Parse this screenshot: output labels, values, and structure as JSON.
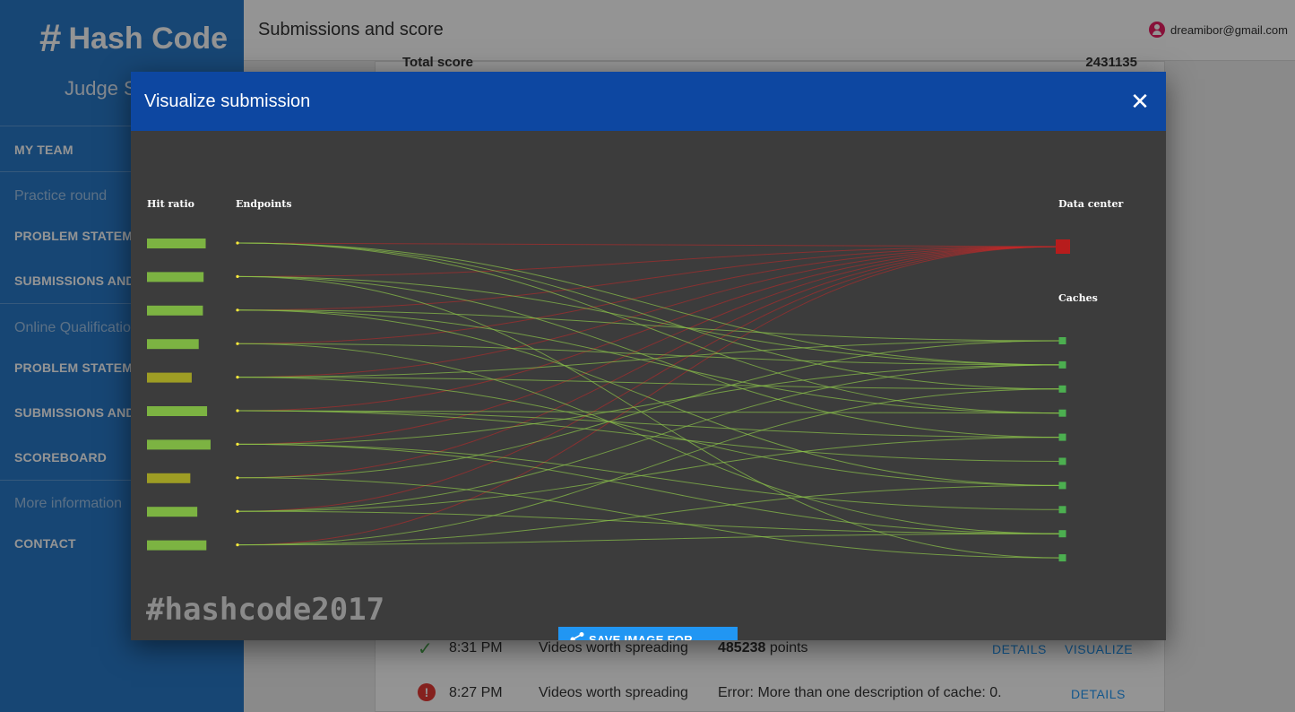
{
  "sidebar": {
    "brand_hash": "#",
    "brand_name": "Hash Code",
    "subtitle": "Judge S",
    "my_team": "MY TEAM",
    "practice_round": "Practice round",
    "practice_problem": "PROBLEM STATEME",
    "practice_submissions": "SUBMISSIONS AND",
    "online_qualification": "Online Qualificatio",
    "online_problem": "PROBLEM STATEME",
    "online_submissions": "SUBMISSIONS AND",
    "scoreboard": "SCOREBOARD",
    "more_information": "More information",
    "contact": "CONTACT"
  },
  "topbar": {
    "title": "Submissions and score",
    "user_email": "dreamibor@gmail.com",
    "user_icon": "account-circle-icon"
  },
  "content": {
    "total_label": "Total score",
    "total_value": "2431135",
    "rows": [
      {
        "status": "ok",
        "time": "8:31 PM",
        "dataset": "Videos worth spreading",
        "score": "485238",
        "score_unit": "points",
        "details": "DETAILS",
        "visualize": "VISUALIZE"
      },
      {
        "status": "error",
        "time": "8:27 PM",
        "dataset": "Videos worth spreading",
        "error": "Error: More than one description of cache: 0.",
        "details": "DETAILS"
      }
    ]
  },
  "dialog": {
    "title": "Visualize submission",
    "close_icon": "close-icon",
    "hit_ratio_label": "Hit ratio",
    "endpoints_label": "Endpoints",
    "data_center_label": "Data center",
    "caches_label": "Caches",
    "watermark": "#hashcode2017",
    "save_button": "SAVE IMAGE FOR SHARING",
    "share_icon": "share-icon",
    "hit_ratios": [
      0.84,
      0.81,
      0.8,
      0.74,
      0.64,
      0.86,
      0.91,
      0.62,
      0.72,
      0.85
    ],
    "cache_count": 10,
    "colors": {
      "header": "#0d47a1",
      "canvas": "#3c3c3c",
      "hit_good": "#7cb342",
      "hit_mid": "#9e9d24",
      "link_green": "#8bc34a",
      "link_red": "#c62828",
      "data_center": "#b71c1c",
      "cache": "#4caf50"
    }
  }
}
